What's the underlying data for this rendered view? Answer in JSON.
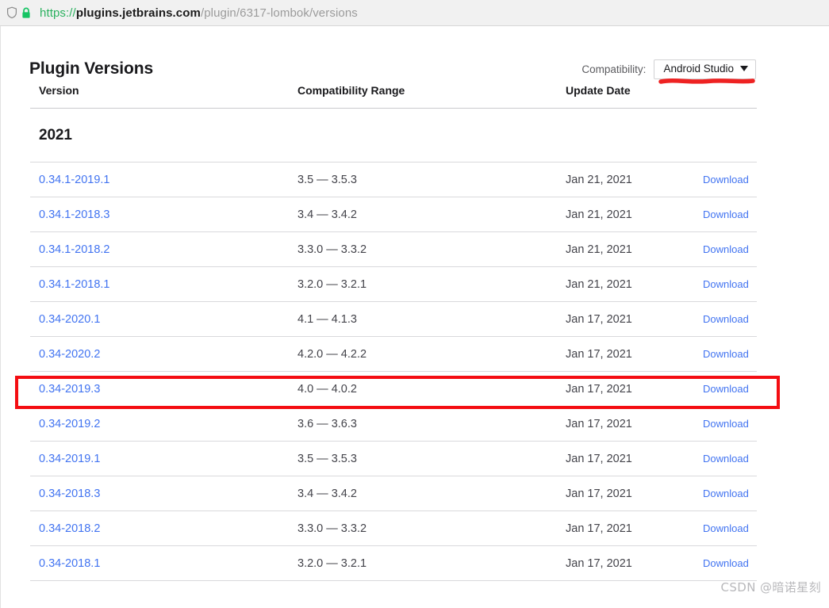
{
  "browser": {
    "icons": [
      "shield-icon",
      "lock-icon"
    ],
    "url": {
      "scheme": "https://",
      "host": "plugins.jetbrains.com",
      "path": "/plugin/6317-lombok/versions"
    }
  },
  "header": {
    "title": "Plugin Versions",
    "compatibility_label": "Compatibility:",
    "compatibility_value": "Android Studio"
  },
  "table": {
    "columns": [
      "Version",
      "Compatibility Range",
      "Update Date",
      ""
    ],
    "year_group": "2021",
    "download_label": "Download",
    "rows": [
      {
        "version": "0.34.1-2019.1",
        "range": "3.5 — 3.5.3",
        "date": "Jan 21, 2021",
        "download": "Download",
        "highlighted": false
      },
      {
        "version": "0.34.1-2018.3",
        "range": "3.4 — 3.4.2",
        "date": "Jan 21, 2021",
        "download": "Download",
        "highlighted": false
      },
      {
        "version": "0.34.1-2018.2",
        "range": "3.3.0 — 3.3.2",
        "date": "Jan 21, 2021",
        "download": "Download",
        "highlighted": false
      },
      {
        "version": "0.34.1-2018.1",
        "range": "3.2.0 — 3.2.1",
        "date": "Jan 21, 2021",
        "download": "Download",
        "highlighted": false
      },
      {
        "version": "0.34-2020.1",
        "range": "4.1 — 4.1.3",
        "date": "Jan 17, 2021",
        "download": "Download",
        "highlighted": false
      },
      {
        "version": "0.34-2020.2",
        "range": "4.2.0 — 4.2.2",
        "date": "Jan 17, 2021",
        "download": "Download",
        "highlighted": true
      },
      {
        "version": "0.34-2019.3",
        "range": "4.0 — 4.0.2",
        "date": "Jan 17, 2021",
        "download": "Download",
        "highlighted": false
      },
      {
        "version": "0.34-2019.2",
        "range": "3.6 — 3.6.3",
        "date": "Jan 17, 2021",
        "download": "Download",
        "highlighted": false
      },
      {
        "version": "0.34-2019.1",
        "range": "3.5 — 3.5.3",
        "date": "Jan 17, 2021",
        "download": "Download",
        "highlighted": false
      },
      {
        "version": "0.34-2018.3",
        "range": "3.4 — 3.4.2",
        "date": "Jan 17, 2021",
        "download": "Download",
        "highlighted": false
      },
      {
        "version": "0.34-2018.2",
        "range": "3.3.0 — 3.3.2",
        "date": "Jan 17, 2021",
        "download": "Download",
        "highlighted": false
      },
      {
        "version": "0.34-2018.1",
        "range": "3.2.0 — 3.2.1",
        "date": "Jan 17, 2021",
        "download": "Download",
        "highlighted": false
      }
    ]
  },
  "annotations": {
    "highlight_color": "#f40d12",
    "underline_color": "#ee2222"
  },
  "watermark": "CSDN @暗诺星刻"
}
